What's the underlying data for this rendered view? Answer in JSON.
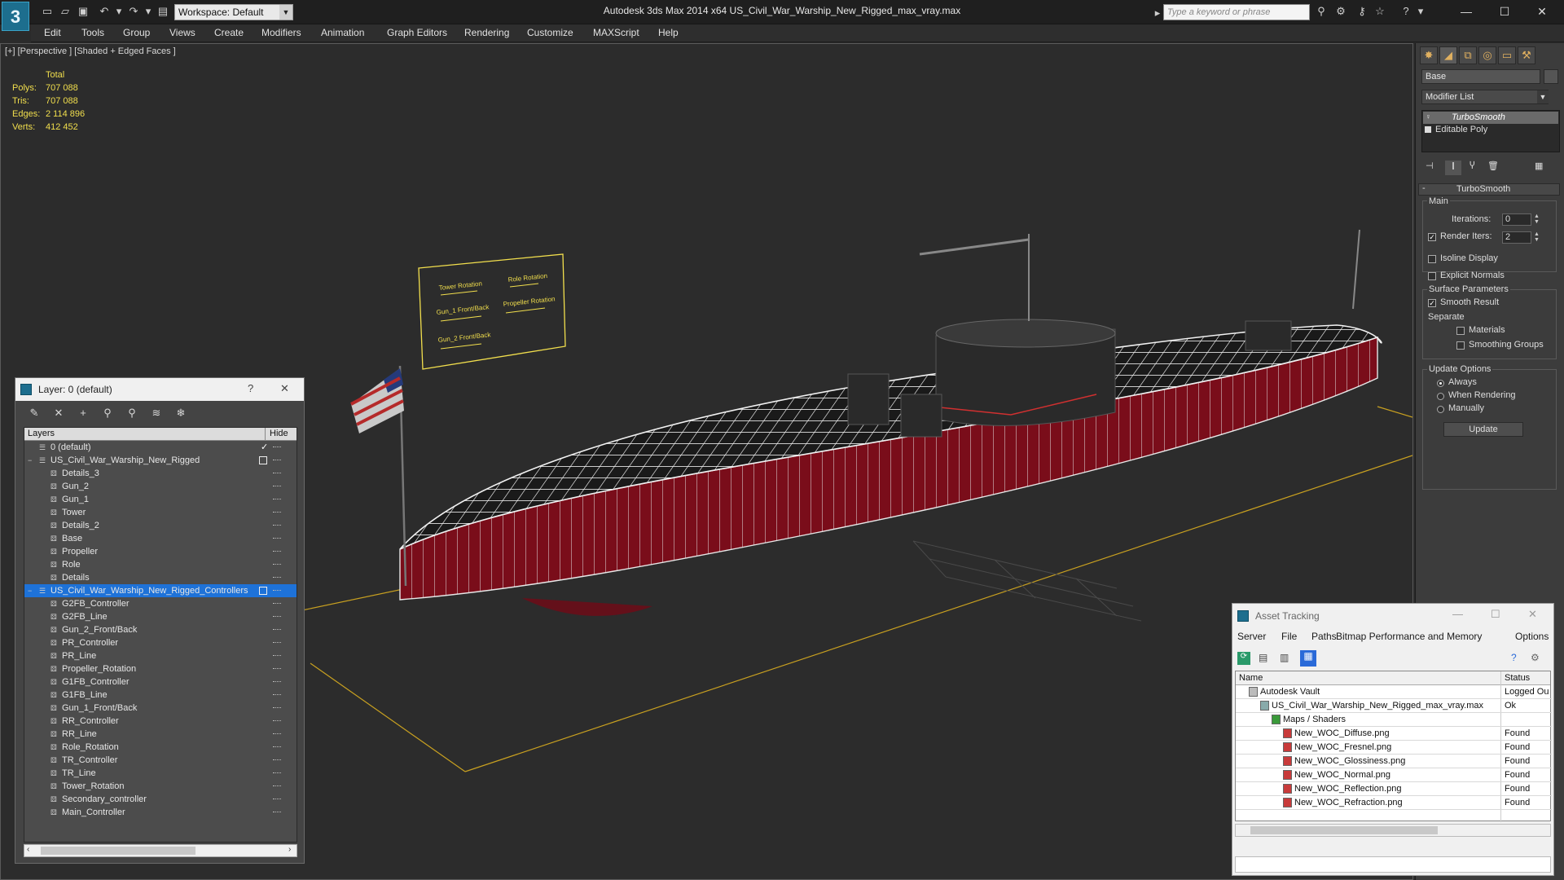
{
  "app": {
    "title": "Autodesk 3ds Max  2014 x64      US_Civil_War_Warship_New_Rigged_max_vray.max",
    "logo": "3",
    "workspace": "Workspace: Default",
    "search_placeholder": "Type a keyword or phrase"
  },
  "menu": [
    "Edit",
    "Tools",
    "Group",
    "Views",
    "Create",
    "Modifiers",
    "Animation",
    "Graph Editors",
    "Rendering",
    "Customize",
    "MAXScript",
    "Help"
  ],
  "viewport": {
    "label": "[+] [Perspective ] [Shaded + Edged Faces ]",
    "stats": {
      "header": "Total",
      "rows": [
        {
          "label": "Polys:",
          "value": "707 088"
        },
        {
          "label": "Tris:",
          "value": "707 088"
        },
        {
          "label": "Edges:",
          "value": "2 114 896"
        },
        {
          "label": "Verts:",
          "value": "412 452"
        }
      ]
    },
    "control_panel_labels": [
      "Tower Rotation",
      "Role Rotation",
      "Gun_1 Front/Back",
      "Propeller Rotation",
      "Gun_2 Front/Back"
    ]
  },
  "command_panel": {
    "object_name": "Base",
    "modifier_list": "Modifier List",
    "stack": [
      "TurboSmooth",
      "Editable Poly"
    ],
    "rollout_title": "TurboSmooth",
    "main_label": "Main",
    "iterations_label": "Iterations:",
    "iterations_value": "0",
    "render_iters_label": "Render Iters:",
    "render_iters_value": "2",
    "isoline": "Isoline Display",
    "explicit_normals": "Explicit Normals",
    "surface_params": "Surface Parameters",
    "smooth_result": "Smooth Result",
    "separate": "Separate",
    "materials": "Materials",
    "smoothing_groups": "Smoothing Groups",
    "update_options": "Update Options",
    "always": "Always",
    "when_rendering": "When Rendering",
    "manually": "Manually",
    "update_button": "Update"
  },
  "layer_dialog": {
    "title": "Layer: 0 (default)",
    "help": "?",
    "close": "✕",
    "col_layers": "Layers",
    "col_hide": "Hide",
    "rows": [
      {
        "name": "0 (default)",
        "level": 0,
        "type": "layer",
        "current": true
      },
      {
        "name": "US_Civil_War_Warship_New_Rigged",
        "level": 0,
        "type": "layer",
        "expand": "−",
        "box": true
      },
      {
        "name": "Details_3",
        "level": 1,
        "type": "obj"
      },
      {
        "name": "Gun_2",
        "level": 1,
        "type": "obj"
      },
      {
        "name": "Gun_1",
        "level": 1,
        "type": "obj"
      },
      {
        "name": "Tower",
        "level": 1,
        "type": "obj"
      },
      {
        "name": "Details_2",
        "level": 1,
        "type": "obj"
      },
      {
        "name": "Base",
        "level": 1,
        "type": "obj"
      },
      {
        "name": "Propeller",
        "level": 1,
        "type": "obj"
      },
      {
        "name": "Role",
        "level": 1,
        "type": "obj"
      },
      {
        "name": "Details",
        "level": 1,
        "type": "obj"
      },
      {
        "name": "US_Civil_War_Warship_New_Rigged_Controllers",
        "level": 0,
        "type": "layer",
        "expand": "−",
        "box": true,
        "selected": true
      },
      {
        "name": "G2FB_Controller",
        "level": 1,
        "type": "obj"
      },
      {
        "name": "G2FB_Line",
        "level": 1,
        "type": "obj"
      },
      {
        "name": "Gun_2_Front/Back",
        "level": 1,
        "type": "obj"
      },
      {
        "name": "PR_Controller",
        "level": 1,
        "type": "obj"
      },
      {
        "name": "PR_Line",
        "level": 1,
        "type": "obj"
      },
      {
        "name": "Propeller_Rotation",
        "level": 1,
        "type": "obj"
      },
      {
        "name": "G1FB_Controller",
        "level": 1,
        "type": "obj"
      },
      {
        "name": "G1FB_Line",
        "level": 1,
        "type": "obj"
      },
      {
        "name": "Gun_1_Front/Back",
        "level": 1,
        "type": "obj"
      },
      {
        "name": "RR_Controller",
        "level": 1,
        "type": "obj"
      },
      {
        "name": "RR_Line",
        "level": 1,
        "type": "obj"
      },
      {
        "name": "Role_Rotation",
        "level": 1,
        "type": "obj"
      },
      {
        "name": "TR_Controller",
        "level": 1,
        "type": "obj"
      },
      {
        "name": "TR_Line",
        "level": 1,
        "type": "obj"
      },
      {
        "name": "Tower_Rotation",
        "level": 1,
        "type": "obj"
      },
      {
        "name": "Secondary_controller",
        "level": 1,
        "type": "obj"
      },
      {
        "name": "Main_Controller",
        "level": 1,
        "type": "obj"
      }
    ]
  },
  "asset_tracking": {
    "title": "Asset Tracking",
    "menu": [
      "Server",
      "File",
      "Paths",
      "Bitmap Performance and Memory",
      "Options"
    ],
    "col_name": "Name",
    "col_status": "Status",
    "rows": [
      {
        "name": "Autodesk Vault",
        "status": "Logged Ou",
        "level": 0,
        "kind": "vault"
      },
      {
        "name": "US_Civil_War_Warship_New_Rigged_max_vray.max",
        "status": "Ok",
        "level": 1,
        "kind": "max"
      },
      {
        "name": "Maps / Shaders",
        "status": "",
        "level": 2,
        "kind": "maps"
      },
      {
        "name": "New_WOC_Diffuse.png",
        "status": "Found",
        "level": 3,
        "kind": "png"
      },
      {
        "name": "New_WOC_Fresnel.png",
        "status": "Found",
        "level": 3,
        "kind": "png"
      },
      {
        "name": "New_WOC_Glossiness.png",
        "status": "Found",
        "level": 3,
        "kind": "png"
      },
      {
        "name": "New_WOC_Normal.png",
        "status": "Found",
        "level": 3,
        "kind": "png"
      },
      {
        "name": "New_WOC_Reflection.png",
        "status": "Found",
        "level": 3,
        "kind": "png"
      },
      {
        "name": "New_WOC_Refraction.png",
        "status": "Found",
        "level": 3,
        "kind": "png"
      }
    ]
  },
  "colors": {
    "stats_yellow": "#f2df4d",
    "selection_blue": "#1e72d8",
    "hull_red": "#7a0d1a",
    "grid_line": "#c8a020"
  }
}
